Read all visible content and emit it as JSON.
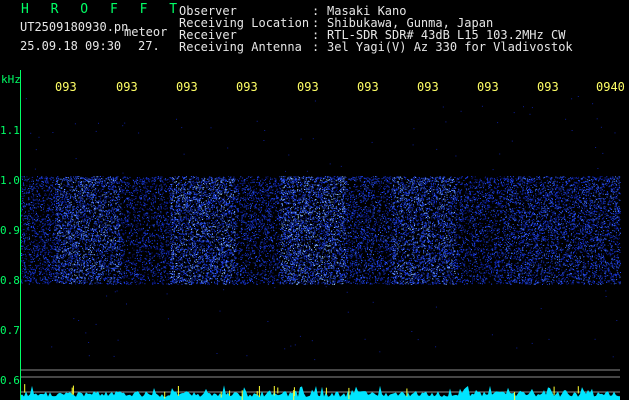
{
  "header": {
    "title": "H R O F F T",
    "filename": "UT2509180930.pn",
    "meteor_label": "meteor",
    "datetime": "25.09.18 09:30",
    "count": "27."
  },
  "meta": [
    {
      "label": "Observer",
      "value": "Masaki Kano"
    },
    {
      "label": "Receiving Location",
      "value": "Shibukawa, Gunma, Japan"
    },
    {
      "label": "Receiver",
      "value": "RTL-SDR SDR# 43dB L15 103.2MHz CW"
    },
    {
      "label": "Receiving Antenna",
      "value": "3el Yagi(V) Az 330 for Vladivostok"
    }
  ],
  "separator": ":",
  "y_axis": {
    "unit": "kHz",
    "ticks": [
      "1.1",
      "1.0",
      "0.9",
      "0.8",
      "0.7",
      "0.6"
    ]
  },
  "x_axis": {
    "ticks": [
      "093",
      "093",
      "093",
      "093",
      "093",
      "093",
      "093",
      "093",
      "093",
      "0940"
    ]
  },
  "colors": {
    "text_green": "#00ff66",
    "text_white": "#e6e6e6",
    "text_yellow": "#ffff66",
    "signal_blue": "#1a3cff",
    "baseline_cyan": "#00e5ff"
  }
}
